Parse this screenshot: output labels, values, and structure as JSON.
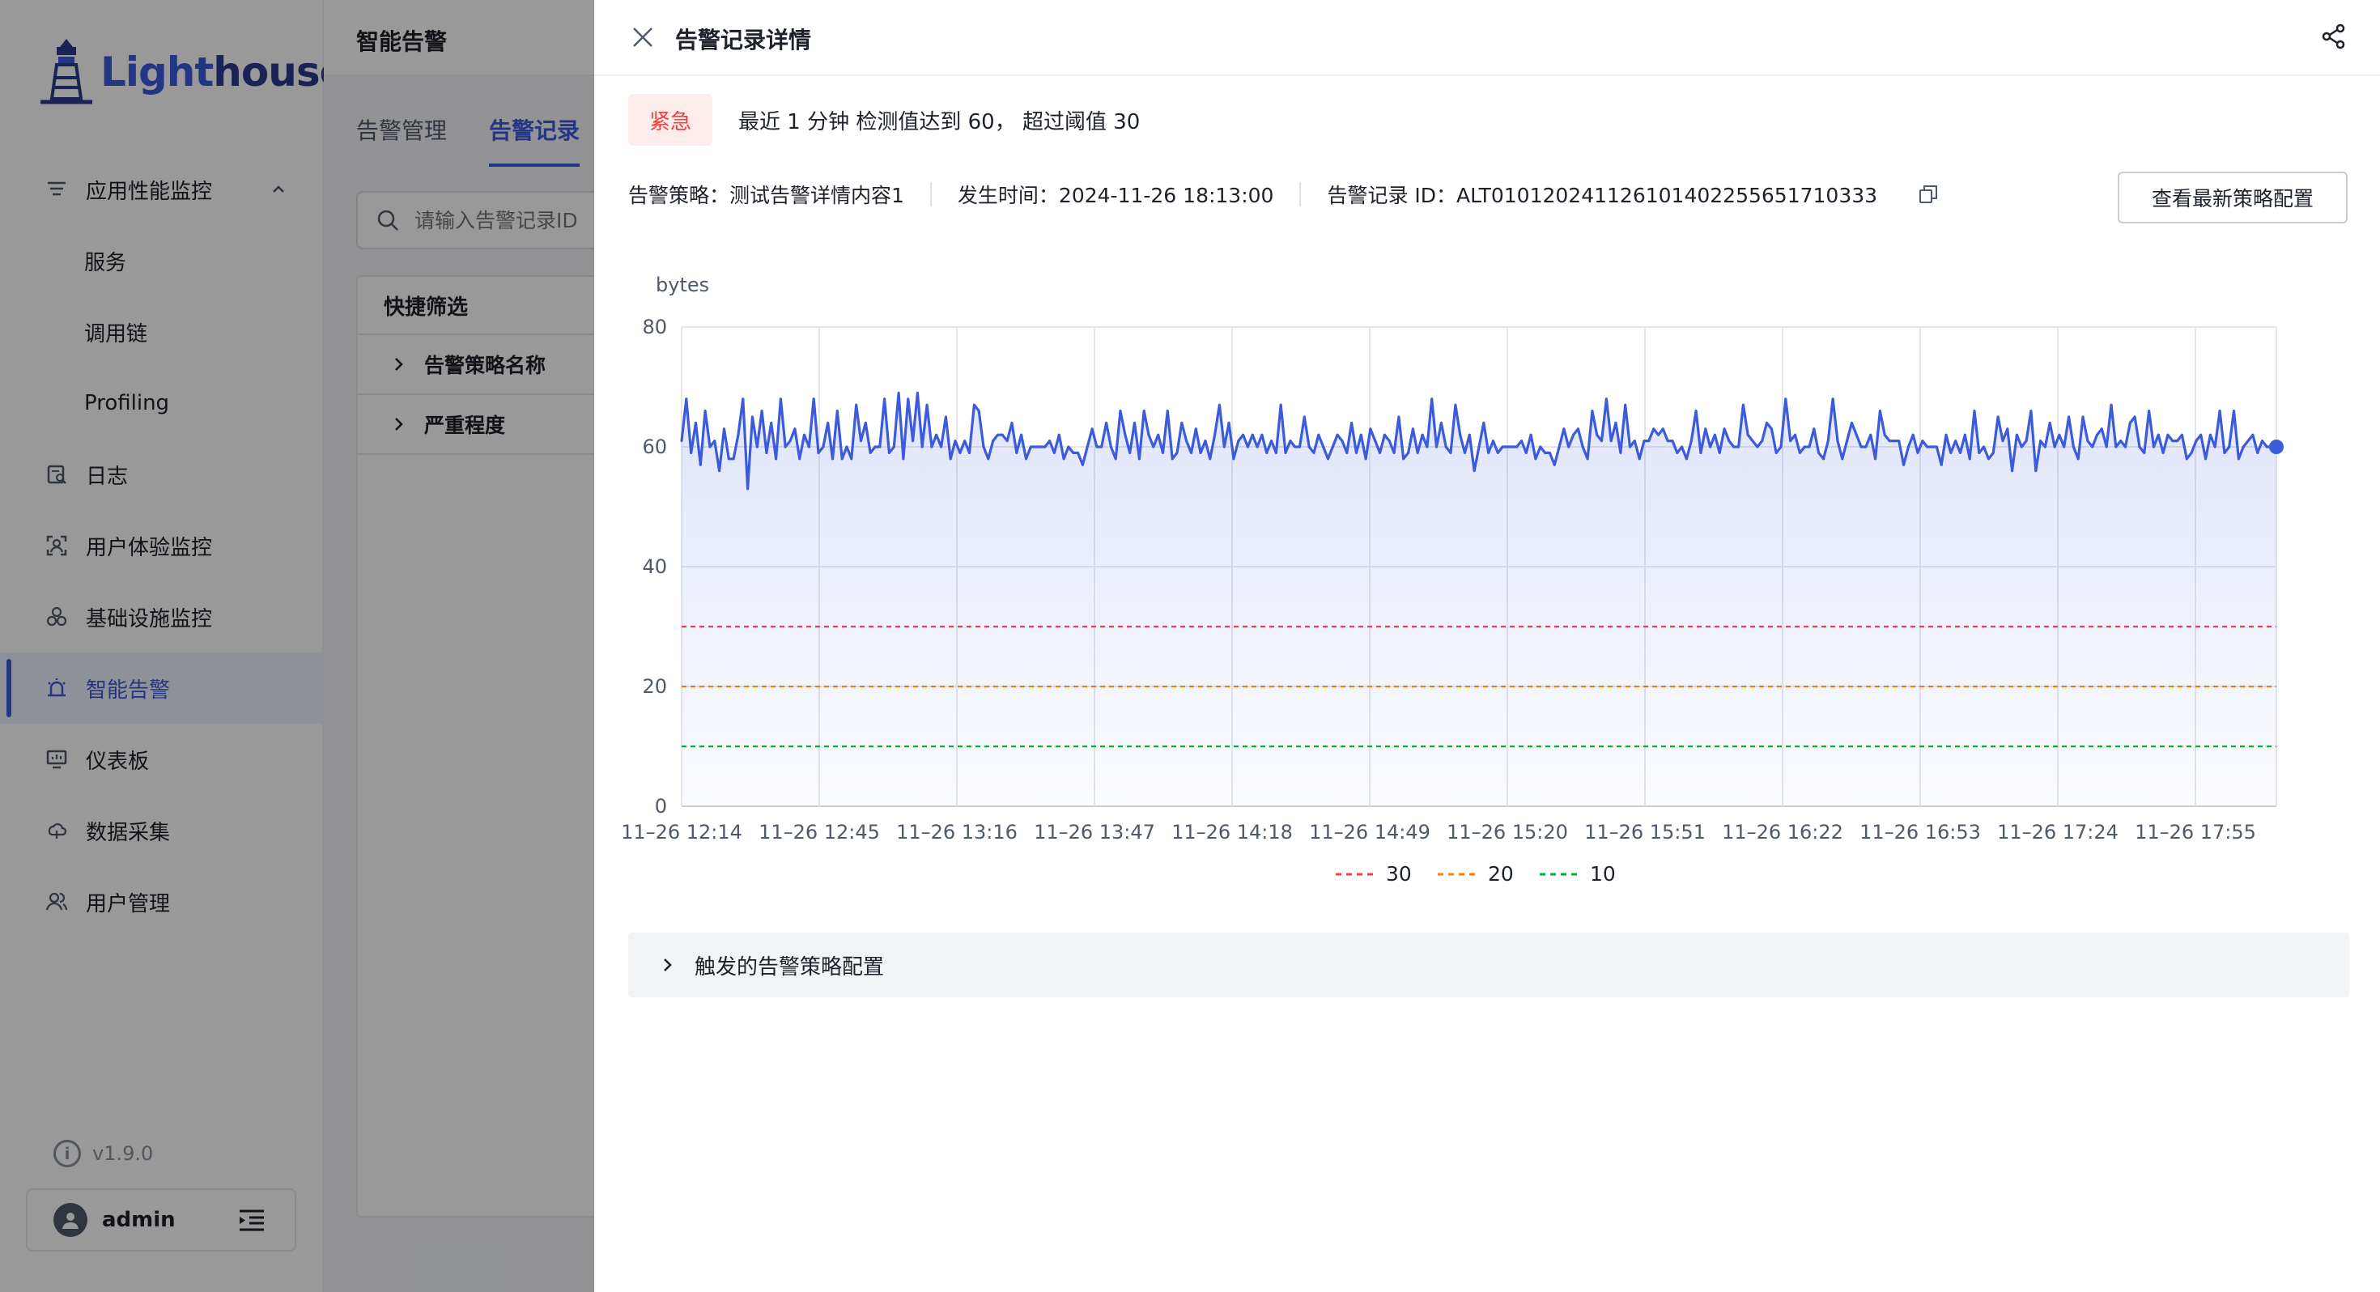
{
  "app": {
    "logo_text": "Lighthouse",
    "version": "v1.9.0",
    "user": "admin"
  },
  "sidebar": {
    "items": [
      {
        "label": "应用性能监控",
        "icon": "apm-icon",
        "expanded": true
      },
      {
        "label": "服务",
        "sub": true
      },
      {
        "label": "调用链",
        "sub": true
      },
      {
        "label": "Profiling",
        "sub": true
      },
      {
        "label": "日志",
        "icon": "log-icon"
      },
      {
        "label": "用户体验监控",
        "icon": "user-experience-icon"
      },
      {
        "label": "基础设施监控",
        "icon": "infrastructure-icon"
      },
      {
        "label": "智能告警",
        "icon": "alarm-icon",
        "active": true
      },
      {
        "label": "仪表板",
        "icon": "dashboard-icon"
      },
      {
        "label": "数据采集",
        "icon": "data-collect-icon"
      },
      {
        "label": "用户管理",
        "icon": "user-manage-icon"
      }
    ]
  },
  "main": {
    "title": "智能告警",
    "tabs": [
      {
        "label": "告警管理",
        "active": false
      },
      {
        "label": "告警记录",
        "active": true
      }
    ],
    "search_placeholder": "请输入告警记录ID",
    "quick_filter": {
      "title": "快捷筛选",
      "rows": [
        "告警策略名称",
        "严重程度"
      ]
    }
  },
  "drawer": {
    "title": "告警记录详情",
    "severity": "紧急",
    "message": "最近 1 分钟 检测值达到 60， 超过阈值 30",
    "policy": "告警策略：测试告警详情内容1",
    "time": "发生时间：2024-11-26 18:13:00",
    "record_id": "告警记录 ID：ALT010120241126101402255651710333",
    "latest_button": "查看最新策略配置",
    "collapse_label": "触发的告警策略配置",
    "colors": {
      "accent": "#3b5bdb",
      "danger": "#f53f3f"
    }
  },
  "chart_data": {
    "type": "area",
    "ylabel": "bytes",
    "ylim": [
      0,
      80
    ],
    "yticks": [
      0,
      20,
      40,
      60,
      80
    ],
    "xticks": [
      "11–26 12:14",
      "11–26 12:45",
      "11–26 13:16",
      "11–26 13:47",
      "11–26 14:18",
      "11–26 14:49",
      "11–26 15:20",
      "11–26 15:51",
      "11–26 16:22",
      "11–26 16:53",
      "11–26 17:24",
      "11–26 17:55"
    ],
    "series_color": "#3b5bdb",
    "values": [
      61,
      68,
      59,
      64,
      57,
      66,
      60,
      61,
      56,
      63,
      58,
      58,
      62,
      68,
      53,
      65,
      60,
      66,
      59,
      64,
      58,
      68,
      60,
      61,
      63,
      58,
      62,
      60,
      68,
      59,
      60,
      64,
      58,
      66,
      58,
      60,
      58,
      67,
      61,
      64,
      59,
      60,
      60,
      68,
      59,
      60,
      69,
      58,
      68,
      61,
      69,
      60,
      67,
      60,
      62,
      60,
      65,
      58,
      61,
      59,
      61,
      59,
      67,
      66,
      60,
      58,
      61,
      62,
      62,
      61,
      64,
      59,
      62,
      58,
      60,
      60,
      60,
      60,
      61,
      59,
      62,
      58,
      60,
      59,
      59,
      57,
      60,
      63,
      60,
      60,
      64,
      60,
      58,
      66,
      62,
      59,
      64,
      58,
      66,
      62,
      60,
      62,
      59,
      66,
      58,
      59,
      64,
      61,
      59,
      63,
      59,
      61,
      58,
      62,
      67,
      60,
      64,
      58,
      61,
      62,
      60,
      62,
      60,
      62,
      59,
      61,
      59,
      67,
      59,
      61,
      60,
      60,
      65,
      60,
      59,
      62,
      60,
      58,
      60,
      62,
      61,
      59,
      64,
      59,
      62,
      58,
      63,
      61,
      59,
      62,
      61,
      59,
      65,
      58,
      59,
      63,
      59,
      62,
      60,
      68,
      60,
      64,
      60,
      59,
      67,
      62,
      59,
      62,
      56,
      60,
      64,
      59,
      61,
      59,
      60,
      60,
      60,
      60,
      61,
      59,
      62,
      58,
      60,
      59,
      59,
      57,
      60,
      63,
      60,
      62,
      63,
      60,
      58,
      66,
      62,
      61,
      68,
      61,
      64,
      59,
      67,
      60,
      61,
      58,
      61,
      61,
      63,
      62,
      63,
      61,
      61,
      59,
      60,
      58,
      61,
      66,
      59,
      63,
      60,
      62,
      59,
      63,
      61,
      60,
      60,
      67,
      62,
      61,
      60,
      61,
      64,
      63,
      59,
      60,
      68,
      61,
      62,
      59,
      60,
      60,
      63,
      59,
      58,
      61,
      68,
      61,
      58,
      61,
      64,
      62,
      60,
      60,
      62,
      58,
      66,
      62,
      61,
      61,
      61,
      57,
      60,
      62,
      59,
      61,
      60,
      60,
      60,
      57,
      62,
      59,
      61,
      59,
      62,
      58,
      66,
      59,
      60,
      58,
      59,
      65,
      61,
      63,
      56,
      62,
      60,
      61,
      66,
      56,
      61,
      60,
      64,
      60,
      62,
      60,
      65,
      60,
      58,
      65,
      61,
      60,
      62,
      63,
      60,
      67,
      60,
      61,
      60,
      64,
      65,
      60,
      59,
      66,
      60,
      62,
      59,
      62,
      61,
      61,
      62,
      58,
      59,
      61,
      62,
      58,
      62,
      60,
      66,
      59,
      60,
      66,
      58,
      60,
      61,
      62,
      59,
      61,
      60,
      60,
      60
    ],
    "thresholds": [
      {
        "name": "30",
        "value": 30,
        "color": "#f53f3f"
      },
      {
        "name": "20",
        "value": 20,
        "color": "#ff7d00"
      },
      {
        "name": "10",
        "value": 10,
        "color": "#00b42a"
      }
    ],
    "legend_position": "bottom-center",
    "grid": true
  }
}
